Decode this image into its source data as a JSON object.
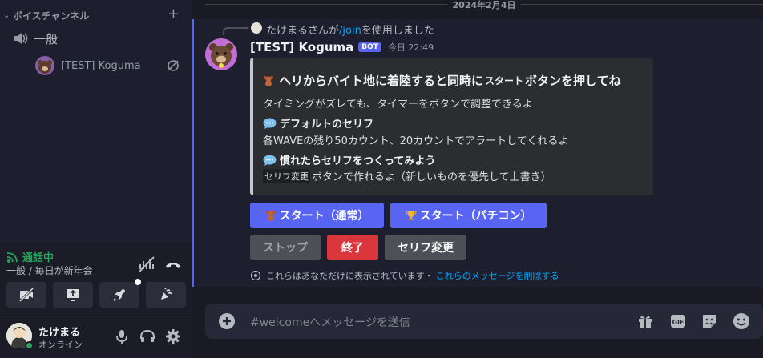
{
  "sidebar": {
    "category_label": "ボイスチャンネル",
    "channel_name": "一般",
    "member_name": "[TEST] Koguma",
    "rtc": {
      "status": "通話中",
      "subtitle": "一般 / 毎日が新年会"
    },
    "user": {
      "name": "たけまる",
      "status": "オンライン"
    }
  },
  "main": {
    "date_divider": "2024年2月4日",
    "reply": {
      "name": "たけまるさんが",
      "command": "/join",
      "suffix": "を使用しました"
    },
    "message": {
      "author": "[TEST] Koguma",
      "bot_tag": "BOT",
      "time": "今日 22:49",
      "embed": {
        "title_pre": "ヘリからバイト地に着陸すると同時に",
        "title_start": "スタート",
        "title_post": "ボタンを押してね",
        "description": "タイミングがズレても、タイマーをボタンで調整できるよ",
        "field1_name": "デフォルトのセリフ",
        "field1_value": "各WAVEの残り50カウント、20カウントでアラートしてくれるよ",
        "field2_name": "慣れたらセリフをつくってみよう",
        "field2_code": "セリフ変更",
        "field2_value": "ボタンで作れるよ（新しいものを優先して上書き）"
      },
      "buttons": {
        "start_normal": "スタート（通常）",
        "start_pachi": "スタート（パチコン）",
        "stop": "ストップ",
        "end": "終了",
        "serif": "セリフ変更"
      },
      "ephemeral": "これらはあなただけに表示されています・",
      "ephemeral_delete": "これらのメッセージを削除する"
    },
    "composer": {
      "placeholder": "#welcomeへメッセージを送信"
    }
  },
  "colors": {
    "blurple": "#5865f2",
    "green": "#23a55a",
    "red": "#da373c",
    "link": "#00a8fc"
  }
}
